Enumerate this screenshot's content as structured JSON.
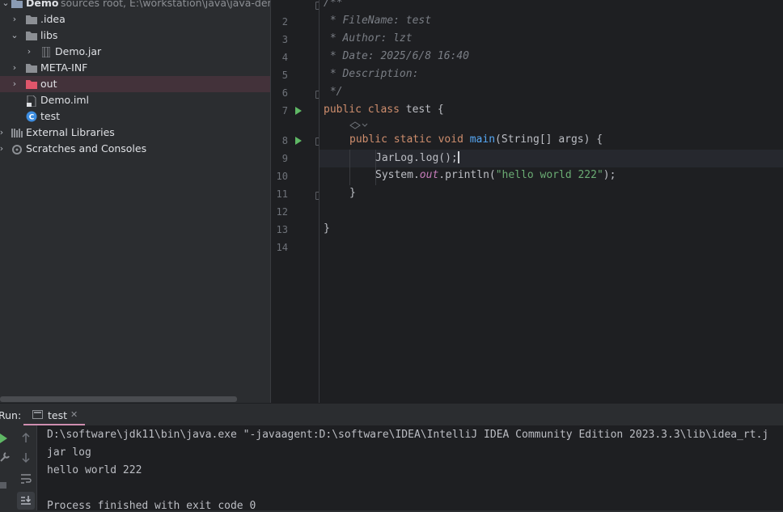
{
  "project": {
    "root_name": "Demo",
    "root_hint": "sources root,  E:\\workstation\\java\\java-demo\\Demo",
    "items": [
      {
        "label": "Demo",
        "hint": "sources root,  E:\\workstation\\java\\java-demo\\Demo"
      },
      {
        "label": ".idea"
      },
      {
        "label": "libs"
      },
      {
        "label": "Demo.jar"
      },
      {
        "label": "META-INF"
      },
      {
        "label": "out"
      },
      {
        "label": "Demo.iml"
      },
      {
        "label": "test"
      },
      {
        "label": "External Libraries"
      },
      {
        "label": "Scratches and Consoles"
      }
    ]
  },
  "editor": {
    "line_numbers": [
      "2",
      "3",
      "4",
      "5",
      "6",
      "7",
      "8",
      "9",
      "10",
      "11",
      "12",
      "13",
      "14"
    ],
    "comment_lines": [
      "/**",
      " * FileName: test",
      " * Author: lzt",
      " * Date: 2025/6/8 16:40",
      " * Description:",
      " */"
    ],
    "class_decl": {
      "kw1": "public",
      "kw2": "class",
      "name": "test {"
    },
    "method_decl": {
      "kw1": "public",
      "kw2": "static",
      "kw3": "void",
      "name": "main",
      "rest": "(String[] args) {"
    },
    "line_jarlog": "JarLog.log();",
    "line_println_pre": "System.",
    "line_println_field": "out",
    "line_println_mid": ".println(",
    "line_println_str": "\"hello world 222\"",
    "line_println_end": ");",
    "close_brace_inner": "}",
    "close_brace_outer": "}"
  },
  "run": {
    "label": "Run:",
    "tab_label": "test",
    "tab_close": "✕",
    "console_lines": [
      "D:\\software\\jdk11\\bin\\java.exe \"-javaagent:D:\\software\\IDEA\\IntelliJ IDEA Community Edition 2023.3.3\\lib\\idea_rt.j",
      "jar log",
      "hello world 222",
      "",
      "Process finished with exit code 0"
    ]
  },
  "colors": {
    "accent_selection": "#43323a",
    "run_green": "#5fb865",
    "error_red": "#e55765",
    "keyword": "#cf8e6d",
    "string": "#6aab73",
    "function": "#56a8f5"
  },
  "icons": [
    "chevron-right-icon",
    "chevron-down-icon",
    "folder-icon",
    "jar-icon",
    "file-icon",
    "class-icon",
    "library-icon",
    "scratches-icon",
    "run-icon",
    "error-bulb-icon",
    "fold-icon",
    "arrow-up-icon",
    "arrow-down-icon",
    "wrench-icon",
    "stop-icon",
    "wrap-icon",
    "scroll-end-icon"
  ]
}
